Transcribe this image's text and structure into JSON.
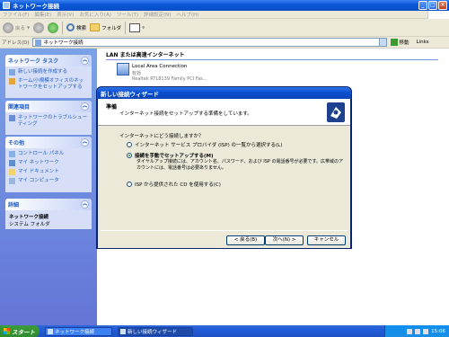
{
  "window": {
    "title": "ネットワーク接続",
    "menu": [
      "ファイル(F)",
      "編集(E)",
      "表示(V)",
      "お気に入り(A)",
      "ツール(T)",
      "詳細設定(N)",
      "ヘルプ(H)"
    ]
  },
  "toolbar": {
    "back_label": "戻る",
    "search_label": "検索",
    "folder_label": "フォルダ"
  },
  "address": {
    "label": "アドレス(D)",
    "value": "ネットワーク接続",
    "go_label": "移動",
    "links_label": "Links"
  },
  "sidebar": {
    "network_tasks": {
      "title": "ネットワーク タスク",
      "items": [
        "新しい接続を作成する",
        "ホーム/小規模オフィスのネットワークをセットアップする"
      ]
    },
    "related": {
      "title": "関連項目",
      "items": [
        "ネットワークのトラブルシューティング"
      ]
    },
    "other": {
      "title": "その他",
      "items": [
        "コントロール パネル",
        "マイ ネットワーク",
        "マイ ドキュメント",
        "マイ コンピュータ"
      ]
    },
    "details": {
      "title": "詳細",
      "name": "ネットワーク接続",
      "sub": "システム フォルダ"
    }
  },
  "content": {
    "heading": "LAN または高速インターネット",
    "connection": {
      "name": "Local Area Connection",
      "status": "有効",
      "device": "Realtek RTL8139 Family PCI Fas..."
    }
  },
  "wizard": {
    "title": "新しい接続ウィザード",
    "heading": "準備",
    "subheading": "インターネット接続をセットアップする準備をしています。",
    "question": "インターネットにどう接続しますか？",
    "options": [
      {
        "label": "インターネット サービス プロバイダ (ISP) の一覧から選択する(L)",
        "selected": false
      },
      {
        "label": "接続を手動でセットアップする(M)",
        "selected": true
      },
      {
        "label": "ISP から提供された CD を使用する(C)",
        "selected": false
      }
    ],
    "option2_desc": "ダイヤルアップ接続には、アカウント名、パスワード、および ISP の電話番号が必要です。広帯域のアカウントには、電話番号は必要ありません。",
    "back_label": "< 戻る(B)",
    "next_label": "次へ(N) >",
    "cancel_label": "キャンセル"
  },
  "taskbar": {
    "start_label": "スタート",
    "tasks": [
      "ネットワーク接続",
      "新しい接続ウィザード"
    ],
    "clock": "15:06"
  }
}
